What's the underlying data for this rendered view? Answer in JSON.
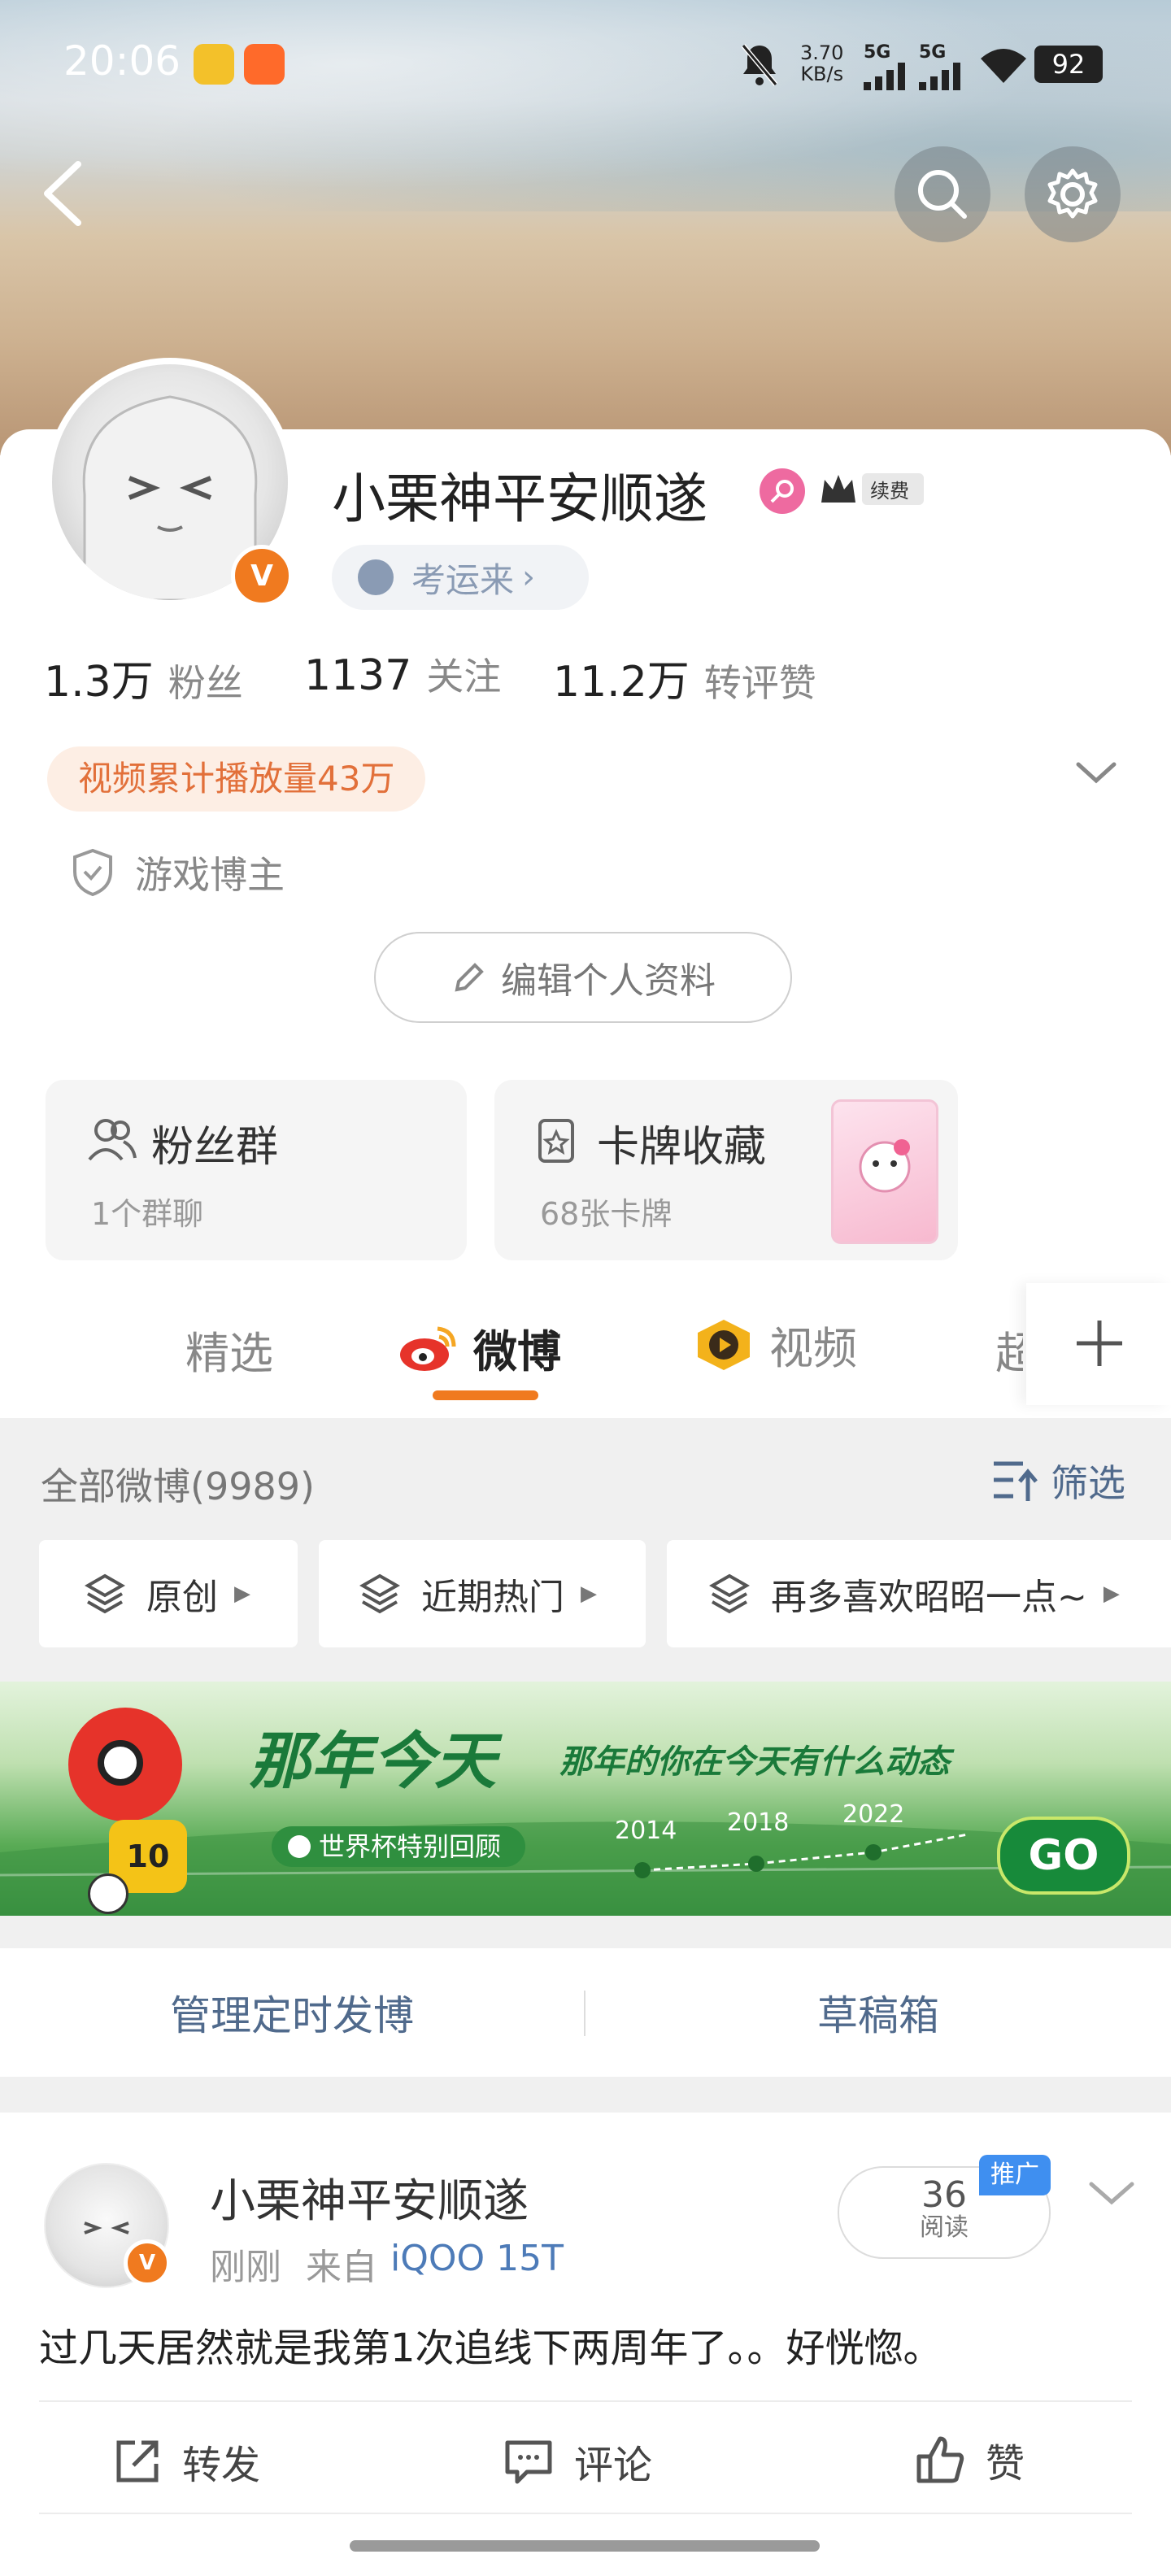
{
  "status_bar": {
    "time": "20:06",
    "net_speed": "3.70",
    "net_unit": "KB/s",
    "sig1": "5G",
    "sig2": "5G",
    "battery": "92"
  },
  "profile": {
    "name": "小栗神平安顺遂",
    "renew_badge": "续费",
    "fortune_link": "考运来",
    "v_mark": "V",
    "stats": [
      {
        "num": "1.3万",
        "label": "粉丝"
      },
      {
        "num": "1137",
        "label": "关注"
      },
      {
        "num": "11.2万",
        "label": "转评赞"
      }
    ],
    "video_plays": "视频累计播放量43万",
    "identity": "游戏博主",
    "edit_label": "编辑个人资料"
  },
  "cards": {
    "fans_group": {
      "title": "粉丝群",
      "sub": "1个群聊"
    },
    "collection": {
      "title": "卡牌收藏",
      "sub": "68张卡牌"
    }
  },
  "tabs": [
    "精选",
    "微博",
    "视频",
    "超"
  ],
  "feed_header": {
    "title": "全部微博(9989)",
    "filter_label": "筛选"
  },
  "chips": [
    "原创",
    "近期热门",
    "再多喜欢昭昭一点~"
  ],
  "banner": {
    "headline": "那年今天",
    "subline": "那年的你在今天有什么动态",
    "tagline": "世界杯特别回顾",
    "years": [
      "2014",
      "2018",
      "2022"
    ],
    "go_label": "GO",
    "jersey_number": "10"
  },
  "manage": {
    "scheduled": "管理定时发博",
    "drafts": "草稿箱"
  },
  "post": {
    "author": "小栗神平安顺遂",
    "time": "刚刚",
    "from_prefix": "来自",
    "device": "iQOO 15T",
    "reads_num": "36",
    "reads_label": "阅读",
    "promo_badge": "推广",
    "text": "过几天居然就是我第1次追线下两周年了。。好恍惚。",
    "actions": [
      "转发",
      "评论",
      "赞"
    ]
  },
  "colors": {
    "accent_orange": "#f07a1f",
    "link_blue": "#506a8c",
    "promo_blue": "#3f8ff0"
  }
}
